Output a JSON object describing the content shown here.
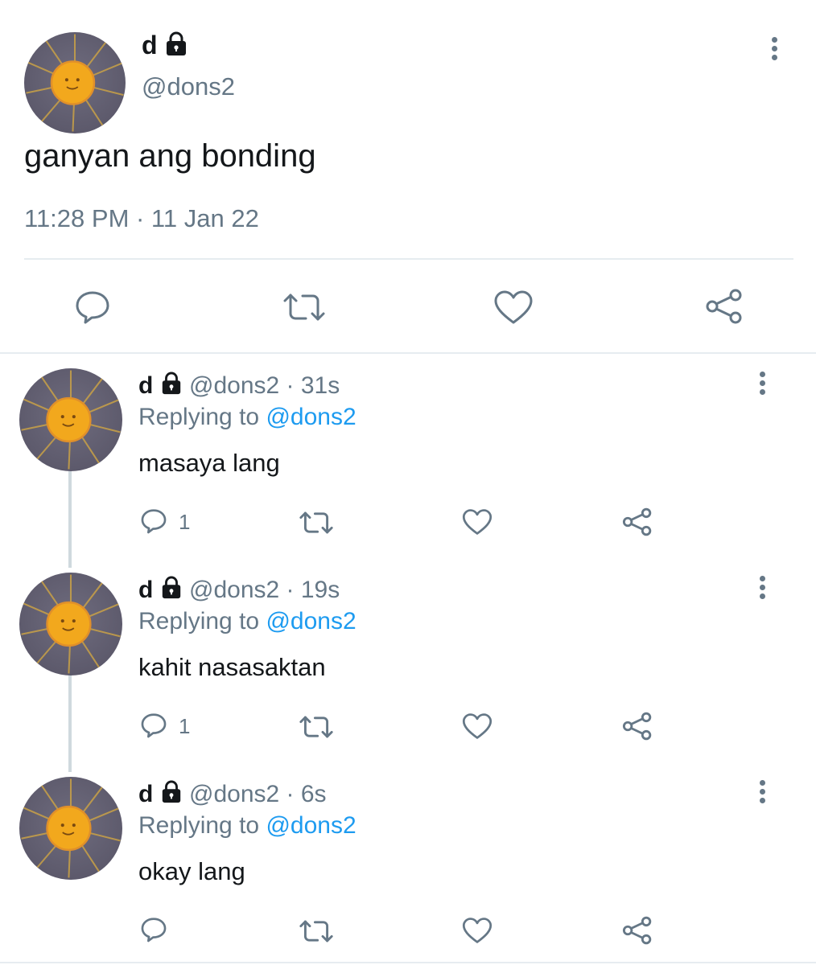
{
  "main_tweet": {
    "name": "d",
    "handle": "@dons2",
    "text": "ganyan ang bonding",
    "timestamp": "11:28 PM · 11 Jan 22"
  },
  "replies": [
    {
      "name": "d",
      "handle_time": "@dons2 · 31s",
      "replying_label": "Replying to",
      "replying_handle": "@dons2",
      "text": "masaya lang",
      "reply_count": "1"
    },
    {
      "name": "d",
      "handle_time": "@dons2 · 19s",
      "replying_label": "Replying to",
      "replying_handle": "@dons2",
      "text": "kahit nasasaktan",
      "reply_count": "1"
    },
    {
      "name": "d",
      "handle_time": "@dons2 · 6s",
      "replying_label": "Replying to",
      "replying_handle": "@dons2",
      "text": "okay lang",
      "reply_count": ""
    }
  ],
  "icons": {
    "reply": "reply-icon",
    "retweet": "retweet-icon",
    "like": "heart-icon",
    "share": "share-icon",
    "more": "more-options-icon",
    "lock": "lock-icon"
  },
  "colors": {
    "text": "#14171a",
    "secondary": "#657786",
    "link": "#1d9bf0",
    "divider": "#e6ecf0"
  }
}
